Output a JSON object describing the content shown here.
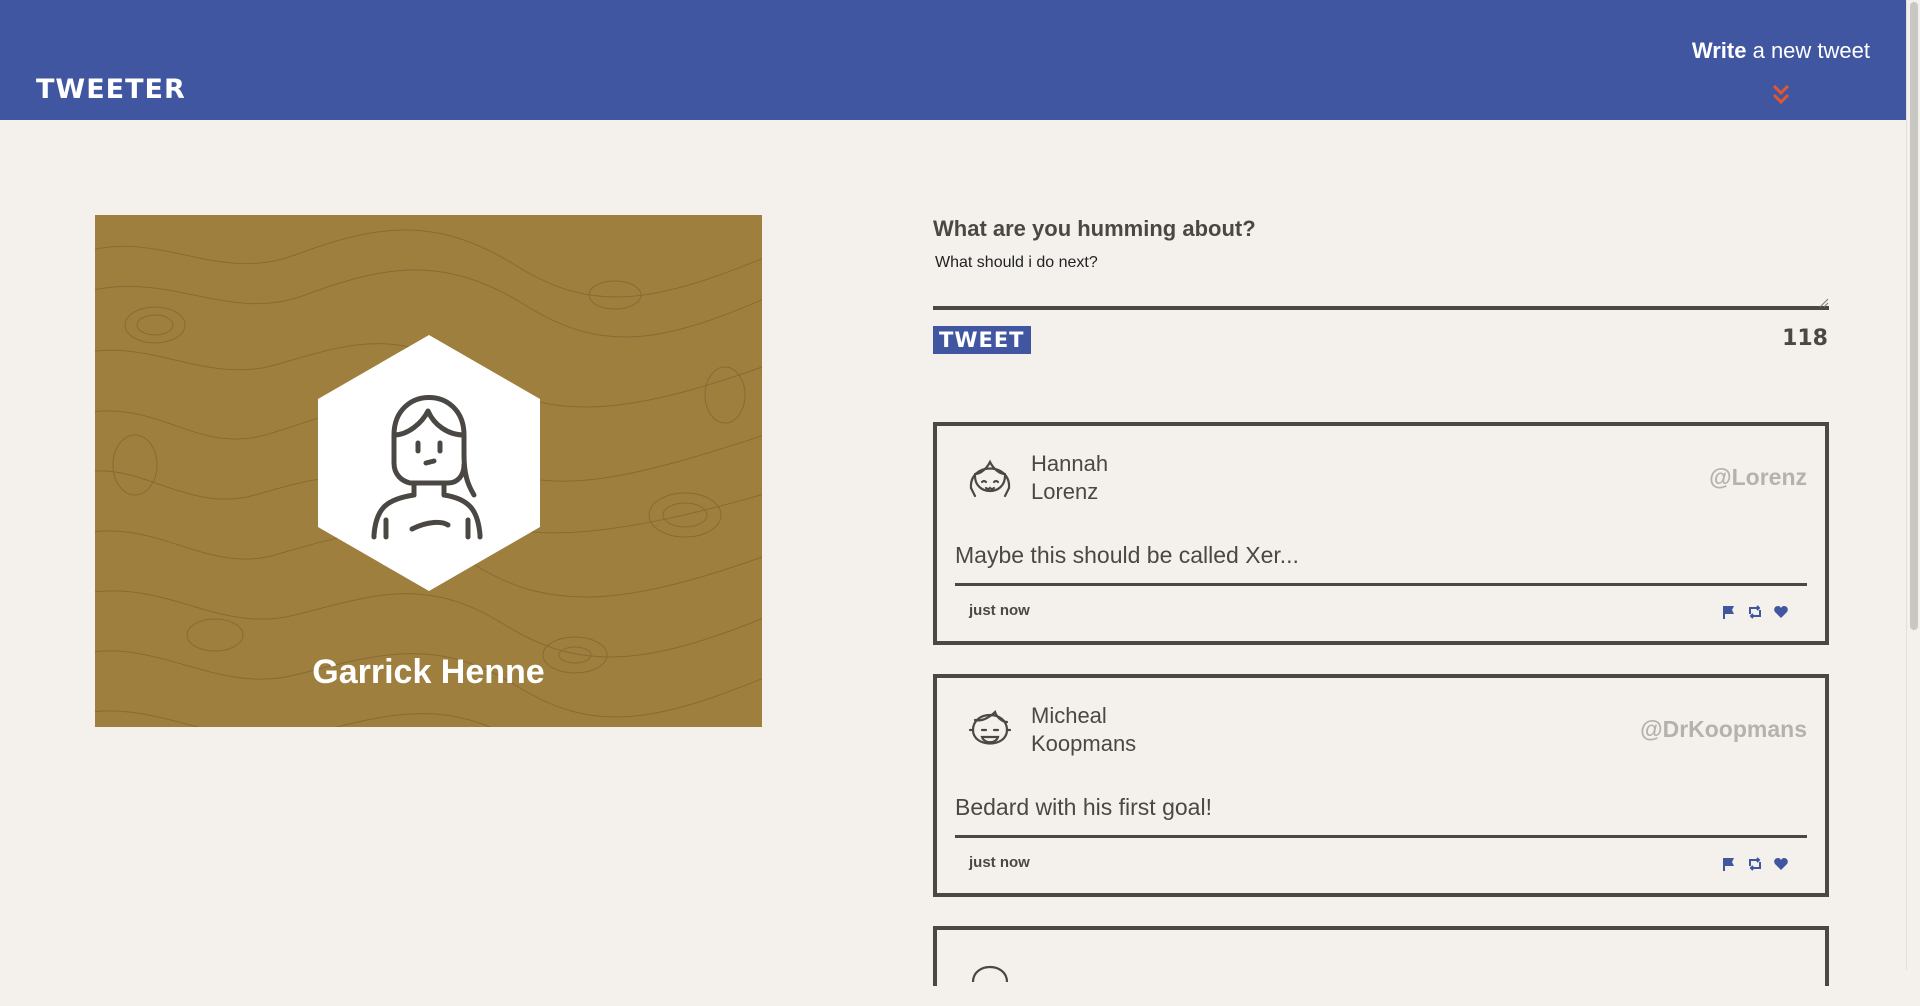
{
  "header": {
    "logo": "TWEETER",
    "write_bold": "Write",
    "write_rest": " a new tweet",
    "accent_color": "#e4572e",
    "bar_color": "#4056a1"
  },
  "profile": {
    "name": "Garrick Henne",
    "card_color": "#9e7f3e",
    "avatar_icon": "woman-avatar-icon"
  },
  "composer": {
    "label": "What are you humming about?",
    "value": "What should i do next?",
    "button_label": "TWEET",
    "char_count": "118"
  },
  "tweets": [
    {
      "first_name": "Hannah",
      "last_name": "Lorenz",
      "handle": "@Lorenz",
      "content": "Maybe this should be called Xer...",
      "time": "just now",
      "avatar_icon": "girl-avatar-icon"
    },
    {
      "first_name": "Micheal",
      "last_name": "Koopmans",
      "handle": "@DrKoopmans",
      "content": "Bedard with his first goal!",
      "time": "just now",
      "avatar_icon": "boy-avatar-icon"
    }
  ],
  "icons": {
    "flag": "flag-icon",
    "retweet": "retweet-icon",
    "like": "heart-icon"
  }
}
